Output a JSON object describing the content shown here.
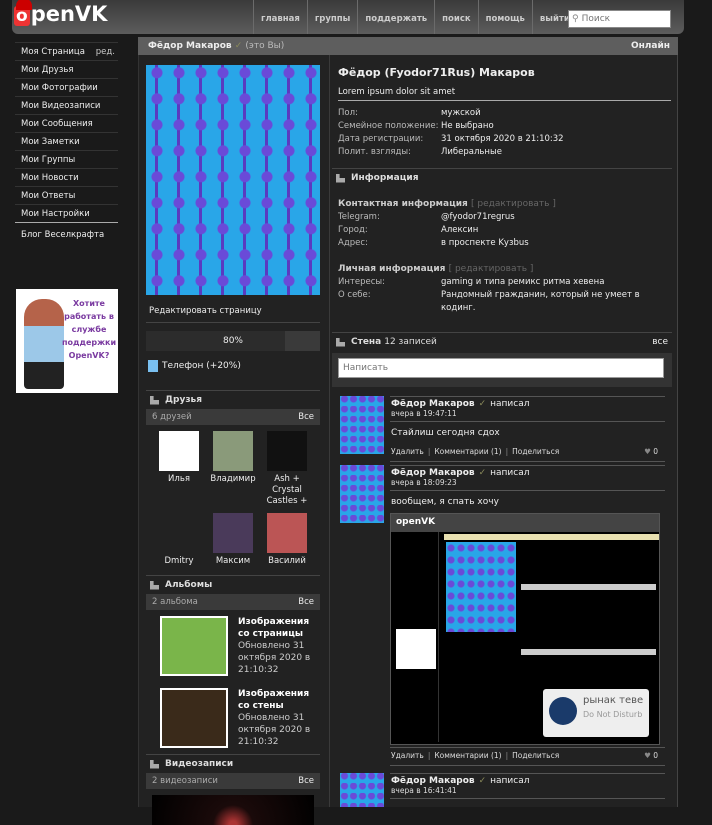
{
  "header": {
    "logo": "openVK",
    "nav": [
      "главная",
      "группы",
      "поддержать",
      "поиск",
      "помощь",
      "выйти"
    ],
    "search_placeholder": "Поиск"
  },
  "sidebar": {
    "items": [
      "Моя Страница",
      "Мои Друзья",
      "Мои Фотографии",
      "Мои Видеозаписи",
      "Мои Сообщения",
      "Мои Заметки",
      "Мои Группы",
      "Мои Новости",
      "Мои Ответы",
      "Мои Настройки"
    ],
    "edit": "ред.",
    "blog": "Блог Веселкрафта",
    "ad_text": "Хотите работать в службе поддержки OpenVK?"
  },
  "profile_header": {
    "name": "Фёдор Макаров",
    "me": "(это Вы)",
    "status": "Онлайн"
  },
  "left": {
    "edit_page": "Редактировать страницу",
    "progress": 80,
    "progress_label": "80%",
    "phone": "Телефон (+20%)",
    "friends": {
      "title": "Друзья",
      "count": "6 друзей",
      "all": "Все",
      "list": [
        {
          "name": "Илья",
          "color": "#fff"
        },
        {
          "name": "Владимир",
          "color": "#8a9a7a"
        },
        {
          "name": "Ash + Crystal Castles +",
          "color": "#111"
        },
        {
          "name": "Dmitry",
          "color": "#222"
        },
        {
          "name": "Максим",
          "color": "#4a3a5a"
        },
        {
          "name": "Василий",
          "color": "#b55"
        }
      ]
    },
    "albums": {
      "title": "Альбомы",
      "count": "2 альбома",
      "all": "Все",
      "list": [
        {
          "title": "Изображения со страницы",
          "date": "Обновлено 31 октября 2020 в 21:10:32",
          "color": "#7ab54a"
        },
        {
          "title": "Изображения со стены",
          "date": "Обновлено 31 октября 2020 в 21:10:32",
          "color": "#3a2a1a"
        }
      ]
    },
    "videos": {
      "title": "Видеозаписи",
      "count": "2 видеозаписи",
      "all": "Все"
    }
  },
  "info": {
    "full_name": "Фёдор (Fyodor71Rus) Макаров",
    "status": "Lorem ipsum dolor sit amet",
    "basic": [
      [
        "Пол:",
        "мужской"
      ],
      [
        "Семейное положение:",
        "Не выбрано"
      ],
      [
        "Дата регистрации:",
        "31 октября 2020 в 21:10:32"
      ],
      [
        "Полит. взгляды:",
        "Либеральные"
      ]
    ],
    "section": "Информация",
    "edit": "[ редактировать ]",
    "contact_title": "Контактная информация",
    "contact": [
      [
        "Telegram:",
        "@fyodor71regrus"
      ],
      [
        "Город:",
        "Алексин"
      ],
      [
        "Адрес:",
        "в проспекте Kузbus"
      ]
    ],
    "personal_title": "Личная информация",
    "personal": [
      [
        "Интересы:",
        "gaming и типа ремикс ритма хевена"
      ],
      [
        "О себе:",
        "Рандомный гражданин, который не умеет в кодинг."
      ]
    ]
  },
  "wall": {
    "title": "Стена",
    "count": "12 записей",
    "all": "все",
    "placeholder": "Написать",
    "posts": [
      {
        "author": "Фёдор Макаров",
        "wrote": "написал",
        "time": "вчера в 19:47:11",
        "text": "Стайлиш сегодня сдох",
        "delete": "Удалить",
        "comments": "Комментарии (1)",
        "share": "Поделиться",
        "likes": "0"
      },
      {
        "author": "Фёдор Макаров",
        "wrote": "написал",
        "time": "вчера в 18:09:23",
        "text": "вообщем, я спать хочу",
        "delete": "Удалить",
        "comments": "Комментарии (1)",
        "share": "Поделиться",
        "likes": "0",
        "shot_logo": "openVK",
        "shot_card_title": "рынак теве",
        "shot_card_sub": "Do Not Disturb"
      },
      {
        "author": "Фёдор Макаров",
        "wrote": "написал",
        "time": "вчера в 16:41:41"
      }
    ]
  }
}
